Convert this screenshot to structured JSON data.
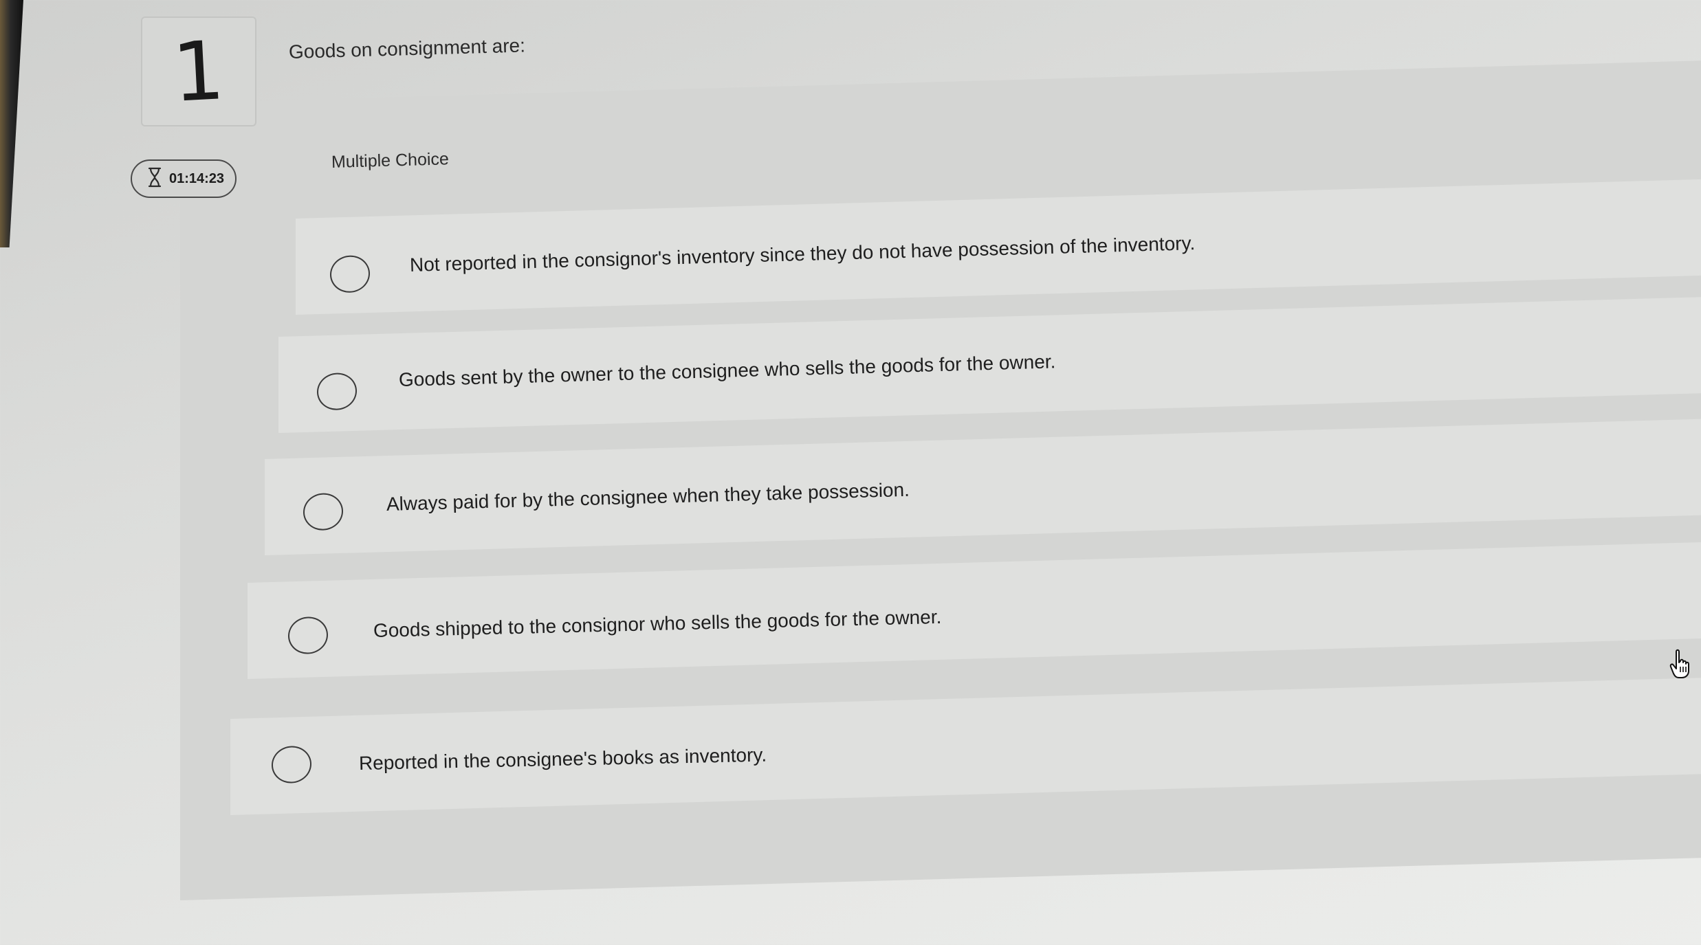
{
  "question": {
    "number": "1",
    "text": "Goods on consignment are:",
    "timer": "01:14:23",
    "type_label": "Multiple Choice"
  },
  "choices": [
    {
      "label": "Not reported in the consignor's inventory since they do not have possession of the inventory.",
      "selected": false
    },
    {
      "label": "Goods sent by the owner to the consignee who sells the goods for the owner.",
      "selected": false
    },
    {
      "label": "Always paid for by the consignee when they take possession.",
      "selected": false
    },
    {
      "label": "Goods shipped to the consignor who sells the goods for the owner.",
      "selected": false
    },
    {
      "label": "Reported in the consignee's books as inventory.",
      "selected": false
    }
  ],
  "icons": {
    "timer": "hourglass-icon",
    "radio": "radio-circle-icon",
    "cursor": "hand-pointer-icon"
  },
  "colors": {
    "panel": "#d4d5d3",
    "choice_row": "#dfe0de",
    "text": "#1e1e1e"
  }
}
